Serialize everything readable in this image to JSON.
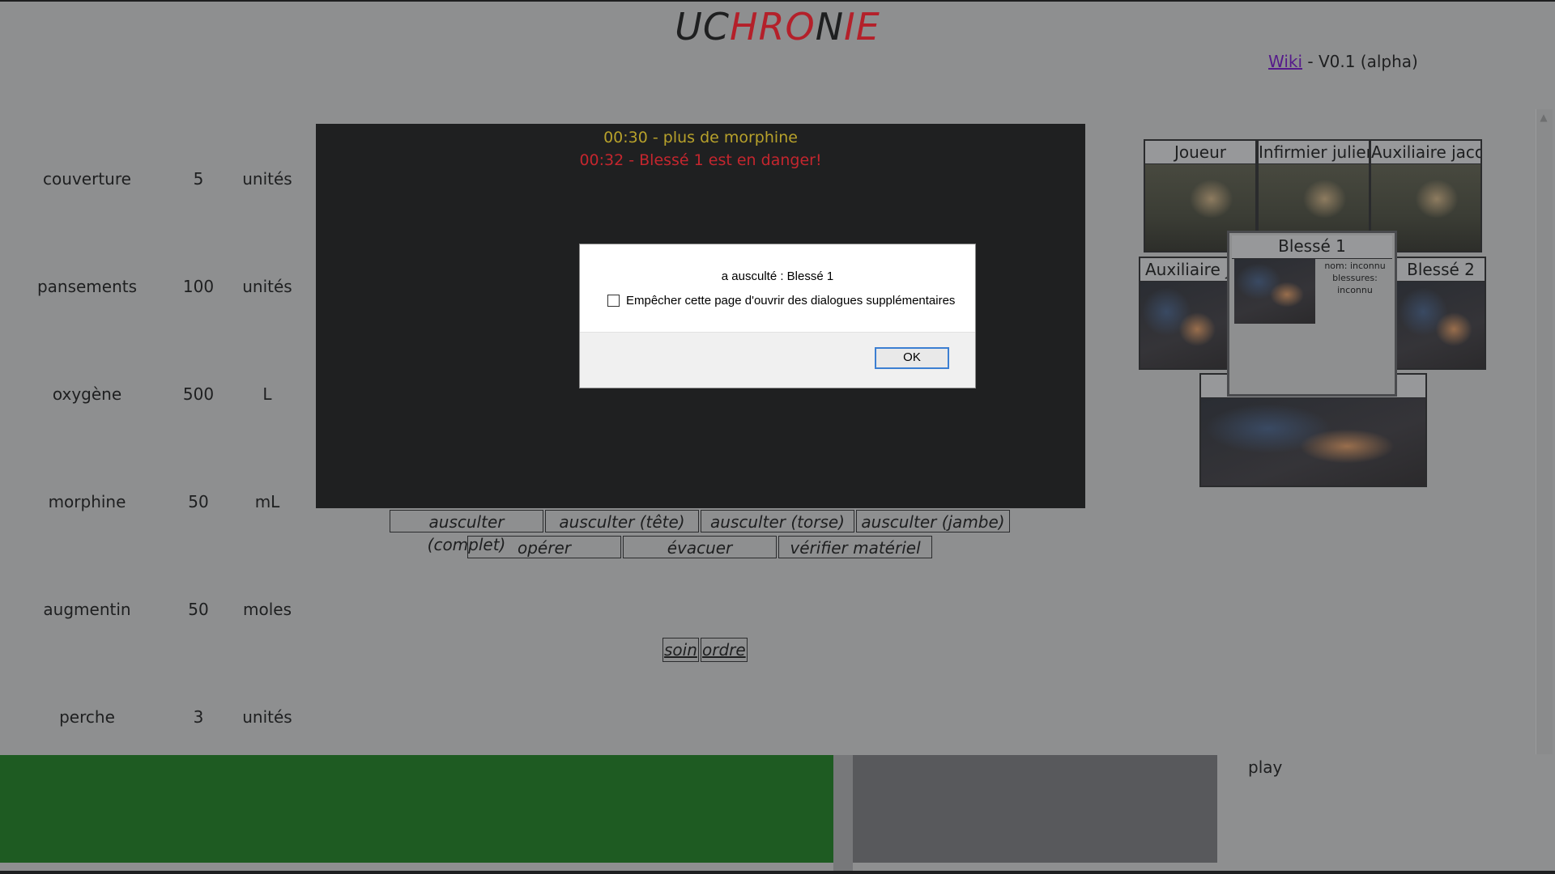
{
  "header": {
    "title_parts": [
      "UC",
      "HRO",
      "N",
      "IE"
    ],
    "wiki_link": "Wiki",
    "version": " - V0.1 (alpha)"
  },
  "resources": [
    {
      "name": "couverture",
      "qty": "5",
      "unit": "unités"
    },
    {
      "name": "pansements",
      "qty": "100",
      "unit": "unités"
    },
    {
      "name": "oxygène",
      "qty": "500",
      "unit": "L"
    },
    {
      "name": "morphine",
      "qty": "50",
      "unit": "mL"
    },
    {
      "name": "augmentin",
      "qty": "50",
      "unit": "moles"
    },
    {
      "name": "perche",
      "qty": "3",
      "unit": "unités"
    }
  ],
  "log": {
    "line1": "00:30 - plus de morphine",
    "line2": "00:32 - Blessé 1 est en danger!",
    "line1_color": "#b7a12b",
    "line2_color": "#c4262e"
  },
  "actions": {
    "row1": [
      "ausculter (complet)",
      "ausculter (tête)",
      "ausculter (torse)",
      "ausculter (jambe)"
    ],
    "row2": [
      "opérer",
      "évacuer",
      "vérifier matériel"
    ],
    "soin": "soin",
    "ordre": "ordre"
  },
  "characters": {
    "joueur": "Joueur",
    "infirmier": "Infirmier julien",
    "auxiliaire_jacob": "Auxiliaire jacob",
    "auxiliaire_ju": "Auxiliaire ju",
    "blesse2": "Blessé 2"
  },
  "popup": {
    "title": "Blessé 1",
    "nom": "nom: inconnu",
    "blessures": "blessures: inconnu"
  },
  "dialog": {
    "message": "a ausculté : Blessé 1",
    "checkbox_label": "Empêcher cette page d'ouvrir des dialogues supplémentaires",
    "ok": "OK"
  },
  "controls": {
    "play": "play"
  },
  "colors": {
    "background": "#8e8f90",
    "title_red": "#b4202a",
    "green_bar": "#1e5b22"
  }
}
